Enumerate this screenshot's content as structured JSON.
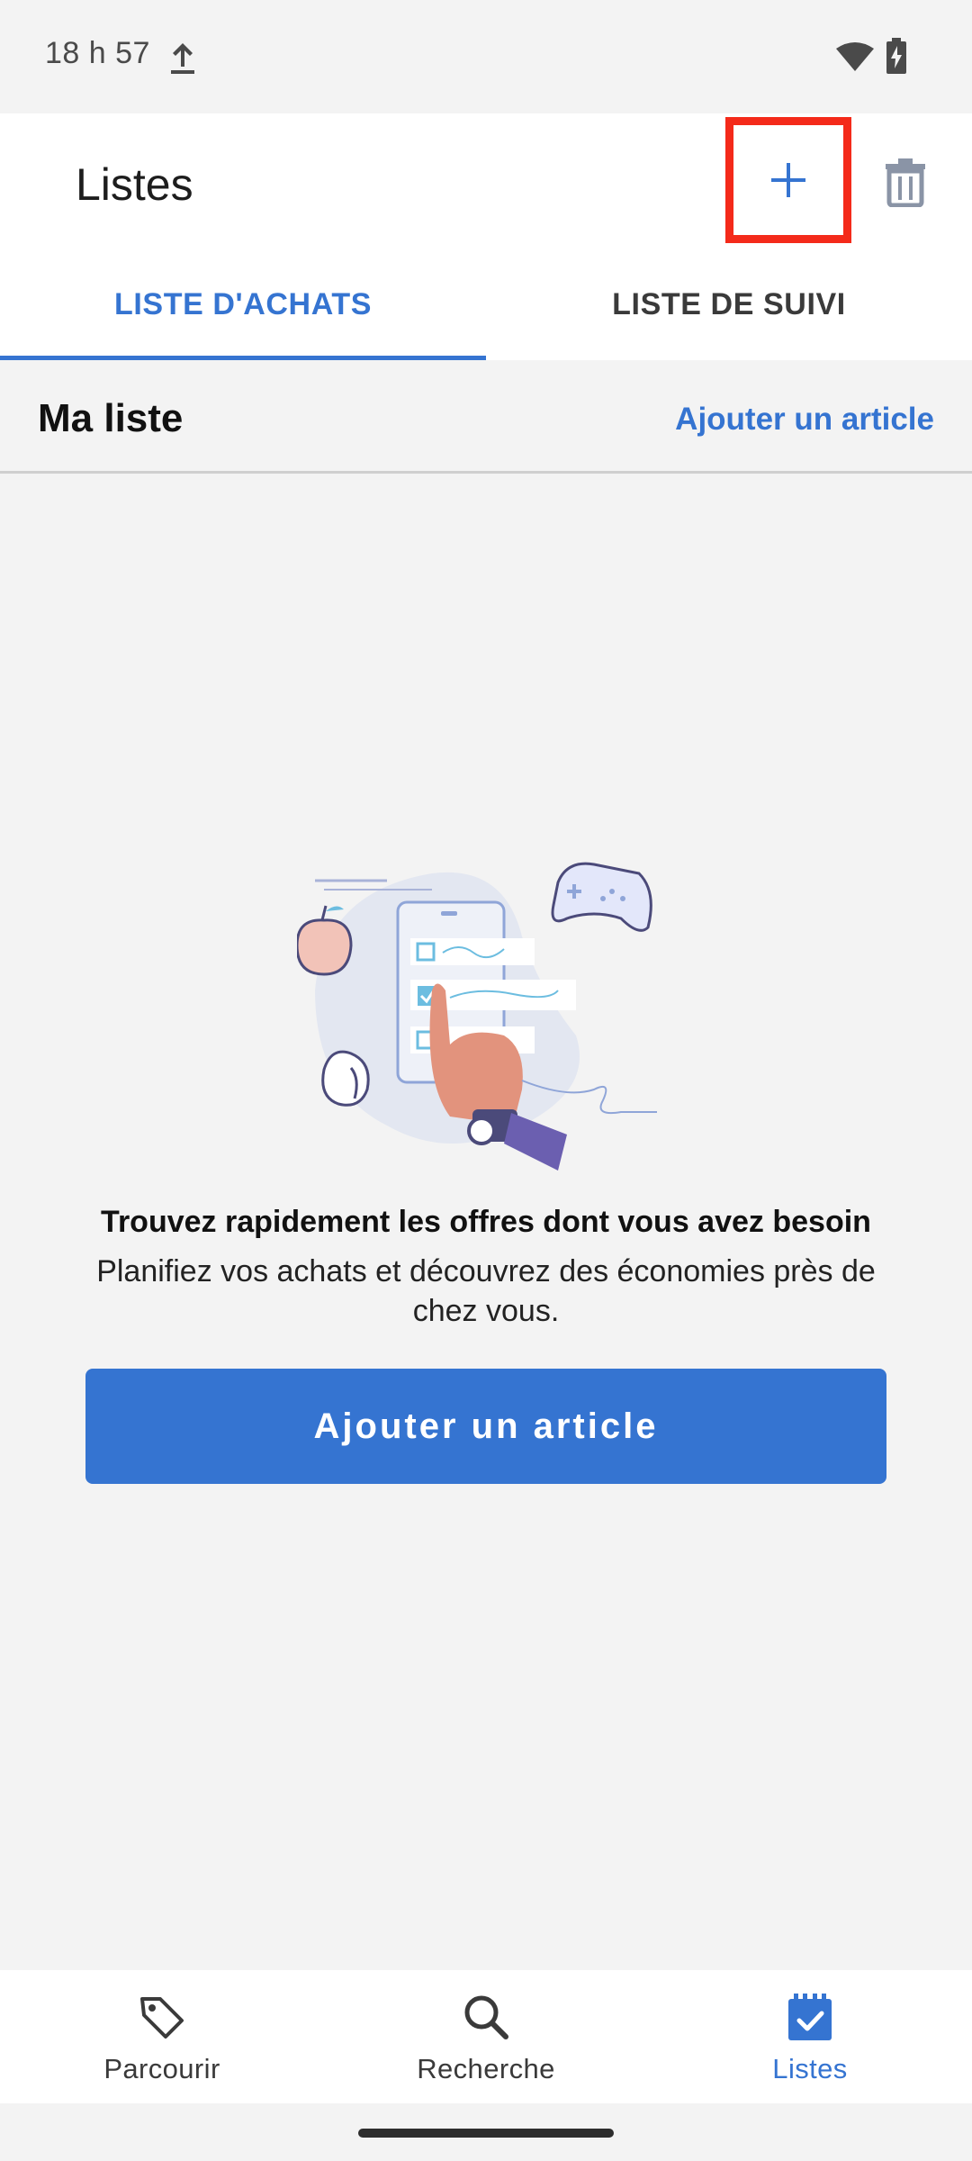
{
  "status_bar": {
    "time": "18 h 57"
  },
  "app_bar": {
    "title": "Listes",
    "add_icon": "plus-icon",
    "delete_icon": "trash-icon",
    "tabs": [
      {
        "label": "LISTE D'ACHATS",
        "active": true
      },
      {
        "label": "LISTE DE SUIVI",
        "active": false
      }
    ]
  },
  "section": {
    "title": "Ma liste",
    "action": "Ajouter un article"
  },
  "empty_state": {
    "title": "Trouvez rapidement les offres dont vous avez besoin",
    "text": "Planifiez vos achats et découvrez des économies près de chez vous.",
    "button": "Ajouter un article"
  },
  "bottom_nav": {
    "items": [
      {
        "label": "Parcourir",
        "icon": "tag-icon",
        "active": false
      },
      {
        "label": "Recherche",
        "icon": "search-icon",
        "active": false
      },
      {
        "label": "Listes",
        "icon": "checklist-icon",
        "active": true
      }
    ]
  },
  "colors": {
    "accent": "#3574d1",
    "highlight_box": "#f42a1a",
    "background": "#f3f3f3"
  }
}
